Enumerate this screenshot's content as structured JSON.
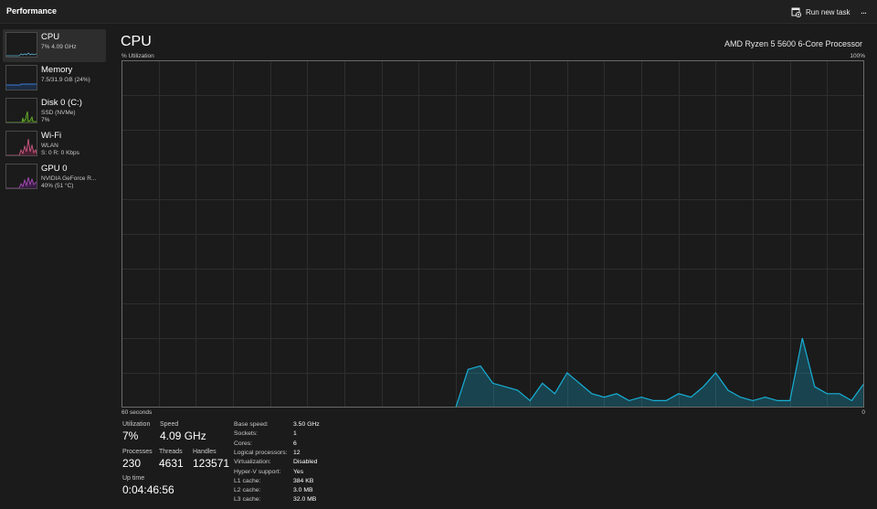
{
  "window": {
    "title": "Performance"
  },
  "toolbar": {
    "run_new_task": "Run new task",
    "more_label": "..."
  },
  "sidebar": {
    "items": [
      {
        "name": "CPU",
        "line1": "7% 4.09 GHz",
        "line2": "",
        "color": "#5fb3d5"
      },
      {
        "name": "Memory",
        "line1": "7.5/31.9 GB (24%)",
        "line2": "",
        "color": "#3a7bd5"
      },
      {
        "name": "Disk 0 (C:)",
        "line1": "SSD (NVMe)",
        "line2": "7%",
        "color": "#6cbf2a"
      },
      {
        "name": "Wi-Fi",
        "line1": "WLAN",
        "line2": "S: 0 R: 0 Kbps",
        "color": "#d8608a"
      },
      {
        "name": "GPU 0",
        "line1": "NVIDIA GeForce R...",
        "line2": "40% (51 °C)",
        "color": "#b04fc0"
      }
    ]
  },
  "main": {
    "title": "CPU",
    "model": "AMD Ryzen 5 5600 6-Core Processor",
    "util_label": "% Utilization",
    "max_label": "100%",
    "time_label": "60 seconds",
    "min_label": "0"
  },
  "stats": {
    "utilization": {
      "label": "Utilization",
      "value": "7%"
    },
    "speed": {
      "label": "Speed",
      "value": "4.09 GHz"
    },
    "processes": {
      "label": "Processes",
      "value": "230"
    },
    "threads": {
      "label": "Threads",
      "value": "4631"
    },
    "handles": {
      "label": "Handles",
      "value": "123571"
    },
    "uptime": {
      "label": "Up time",
      "value": "0:04:46:56"
    }
  },
  "specs": [
    {
      "label": "Base speed:",
      "value": "3.50 GHz"
    },
    {
      "label": "Sockets:",
      "value": "1"
    },
    {
      "label": "Cores:",
      "value": "6"
    },
    {
      "label": "Logical processors:",
      "value": "12"
    },
    {
      "label": "Virtualization:",
      "value": "Disabled"
    },
    {
      "label": "Hyper-V support:",
      "value": "Yes"
    },
    {
      "label": "L1 cache:",
      "value": "384 KB"
    },
    {
      "label": "L2 cache:",
      "value": "3.0 MB"
    },
    {
      "label": "L3 cache:",
      "value": "32.0 MB"
    }
  ],
  "chart_data": {
    "type": "area",
    "title": "CPU",
    "ylabel": "% Utilization",
    "xlabel": "60 seconds",
    "xlim": [
      60,
      0
    ],
    "ylim": [
      0,
      100
    ],
    "grid": true,
    "color": "#17b0d8",
    "x": [
      60,
      59,
      58,
      57,
      56,
      55,
      54,
      53,
      52,
      51,
      50,
      49,
      48,
      47,
      46,
      45,
      44,
      43,
      42,
      41,
      40,
      39,
      38,
      37,
      36,
      35,
      34,
      33,
      32,
      31,
      30,
      29,
      28,
      27,
      26,
      25,
      24,
      23,
      22,
      21,
      20,
      19,
      18,
      17,
      16,
      15,
      14,
      13,
      12,
      11,
      10,
      9,
      8,
      7,
      6,
      5,
      4,
      3,
      2,
      1,
      0
    ],
    "values": [
      0,
      0,
      0,
      0,
      0,
      0,
      0,
      0,
      0,
      0,
      0,
      0,
      0,
      0,
      0,
      0,
      0,
      0,
      0,
      0,
      0,
      0,
      0,
      0,
      0,
      0,
      0,
      0,
      11,
      12,
      7,
      6,
      5,
      2,
      7,
      4,
      10,
      7,
      4,
      3,
      4,
      2,
      3,
      2,
      2,
      4,
      3,
      6,
      10,
      5,
      3,
      2,
      3,
      2,
      2,
      20,
      6,
      4,
      4,
      2,
      7
    ]
  }
}
